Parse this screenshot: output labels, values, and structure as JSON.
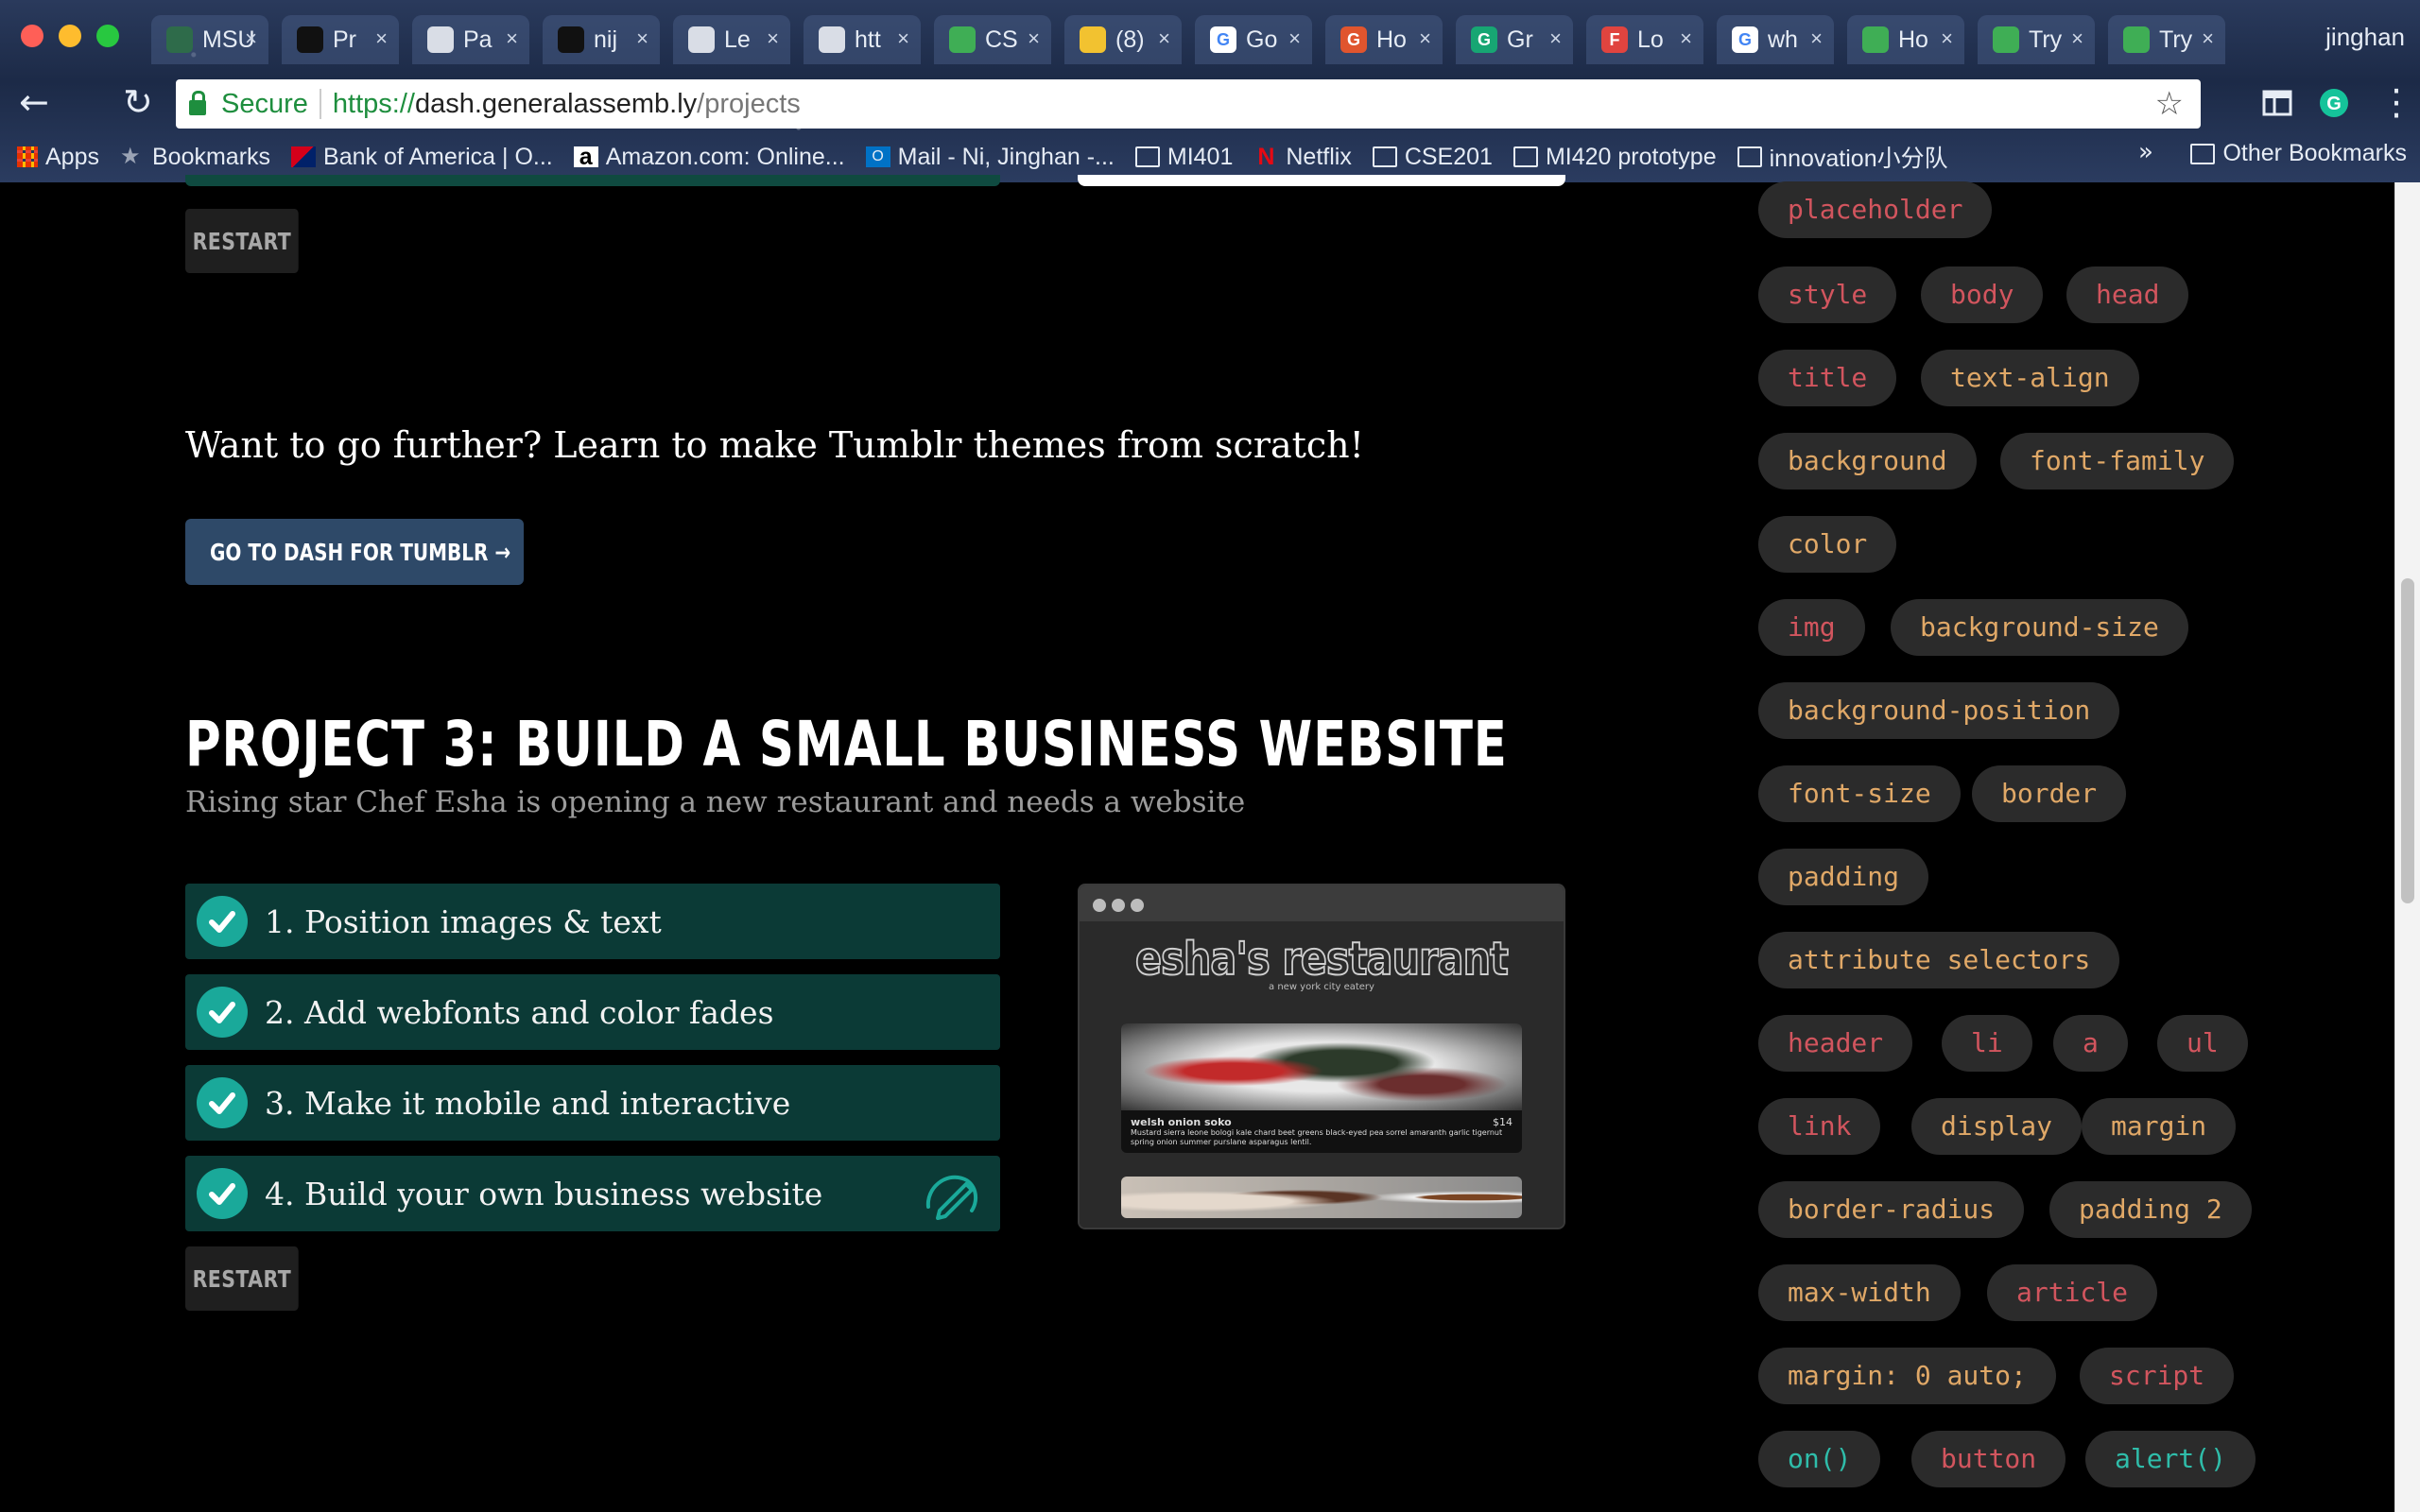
{
  "browser": {
    "tabs": [
      {
        "label": "MSU",
        "fav_color": "#2e6b4a",
        "fav_text": ""
      },
      {
        "label": "Pr",
        "fav_color": "#111111",
        "fav_text": ""
      },
      {
        "label": "Pa",
        "fav_color": "#d9dde6",
        "fav_text": ""
      },
      {
        "label": "nij",
        "fav_color": "#111111",
        "fav_text": ""
      },
      {
        "label": "Le",
        "fav_color": "#d9dde6",
        "fav_text": ""
      },
      {
        "label": "htt",
        "fav_color": "#d9dde6",
        "fav_text": ""
      },
      {
        "label": "CS",
        "fav_color": "#3fae55",
        "fav_text": ""
      },
      {
        "label": "(8)",
        "fav_color": "#f2c230",
        "fav_text": ""
      },
      {
        "label": "Go",
        "fav_color": "#ffffff",
        "fav_text": "G"
      },
      {
        "label": "Ho",
        "fav_color": "#e0552e",
        "fav_text": "G"
      },
      {
        "label": "Gr",
        "fav_color": "#17a673",
        "fav_text": "G"
      },
      {
        "label": "Lo",
        "fav_color": "#e0443f",
        "fav_text": "F"
      },
      {
        "label": "wh",
        "fav_color": "#ffffff",
        "fav_text": "G"
      },
      {
        "label": "Ho",
        "fav_color": "#3fae55",
        "fav_text": ""
      },
      {
        "label": "Try",
        "fav_color": "#3fae55",
        "fav_text": ""
      },
      {
        "label": "Try",
        "fav_color": "#3fae55",
        "fav_text": ""
      }
    ],
    "user_name": "jinghan",
    "secure_label": "Secure",
    "url_scheme": "https://",
    "url_host": "dash.generalassemb.ly",
    "url_path": "/projects",
    "bookmarks": [
      {
        "label": "Apps",
        "icon": "apps-grid-icon"
      },
      {
        "label": "Bookmarks",
        "icon": "star-icon"
      },
      {
        "label": "Bank of America | O...",
        "icon": "bank-of-america-icon"
      },
      {
        "label": "Amazon.com: Online...",
        "icon": "amazon-icon"
      },
      {
        "label": "Mail - Ni, Jinghan -...",
        "icon": "outlook-icon"
      },
      {
        "label": "MI401",
        "icon": "folder-icon"
      },
      {
        "label": "Netflix",
        "icon": "netflix-icon"
      },
      {
        "label": "CSE201",
        "icon": "folder-icon"
      },
      {
        "label": "MI420 prototype",
        "icon": "folder-icon"
      },
      {
        "label": "innovation小分队",
        "icon": "folder-icon"
      }
    ],
    "other_bookmarks": "Other Bookmarks",
    "overflow_chevron": "»"
  },
  "page": {
    "restart_label": "RESTART",
    "further_text": "Want to go further? Learn to make Tumblr themes from scratch!",
    "dash_button": "GO TO DASH FOR TUMBLR →",
    "project_title": "PROJECT 3: BUILD A SMALL BUSINESS WEBSITE",
    "project_subtitle": "Rising star Chef Esha is opening a new restaurant and needs a website",
    "steps": [
      {
        "label": "1. Position images & text",
        "completed": true
      },
      {
        "label": "2. Add webfonts and color fades",
        "completed": true
      },
      {
        "label": "3. Make it mobile and interactive",
        "completed": true
      },
      {
        "label": "4. Build your own business website",
        "completed": true
      }
    ],
    "preview": {
      "title": "esha's restaurant",
      "tagline": "a new york city eatery",
      "dish_name": "welsh onion soko",
      "dish_price": "$14",
      "dish_desc": "Mustard sierra leone bologi kale chard beet greens black-eyed pea sorrel amaranth garlic tigernut spring onion summer purslane asparagus lentil."
    }
  },
  "tags": [
    {
      "label": "placeholder",
      "color": "red"
    },
    {
      "label": "style",
      "color": "red"
    },
    {
      "label": "body",
      "color": "red"
    },
    {
      "label": "head",
      "color": "red"
    },
    {
      "label": "title",
      "color": "red"
    },
    {
      "label": "text-align",
      "color": "orange"
    },
    {
      "label": "background",
      "color": "orange"
    },
    {
      "label": "font-family",
      "color": "orange"
    },
    {
      "label": "color",
      "color": "orange"
    },
    {
      "label": "img",
      "color": "red"
    },
    {
      "label": "background-size",
      "color": "orange"
    },
    {
      "label": "background-position",
      "color": "orange"
    },
    {
      "label": "font-size",
      "color": "orange"
    },
    {
      "label": "border",
      "color": "orange"
    },
    {
      "label": "padding",
      "color": "orange"
    },
    {
      "label": "attribute selectors",
      "color": "orange"
    },
    {
      "label": "header",
      "color": "red"
    },
    {
      "label": "li",
      "color": "red"
    },
    {
      "label": "a",
      "color": "red"
    },
    {
      "label": "ul",
      "color": "red"
    },
    {
      "label": "link",
      "color": "red"
    },
    {
      "label": "display",
      "color": "orange"
    },
    {
      "label": "margin",
      "color": "orange"
    },
    {
      "label": "border-radius",
      "color": "orange"
    },
    {
      "label": "padding 2",
      "color": "orange"
    },
    {
      "label": "max-width",
      "color": "orange"
    },
    {
      "label": "article",
      "color": "red"
    },
    {
      "label": "margin: 0 auto;",
      "color": "orange"
    },
    {
      "label": "script",
      "color": "red"
    },
    {
      "label": "on()",
      "color": "teal"
    },
    {
      "label": "button",
      "color": "red"
    },
    {
      "label": "alert()",
      "color": "teal"
    }
  ],
  "colors": {
    "step_bg": "#0b3a36",
    "check_bg": "#1aa99a",
    "dash_button_bg": "#2e4968",
    "tag_red": "#d2555e",
    "tag_orange": "#e0a867",
    "tag_teal": "#2fbdaa"
  }
}
